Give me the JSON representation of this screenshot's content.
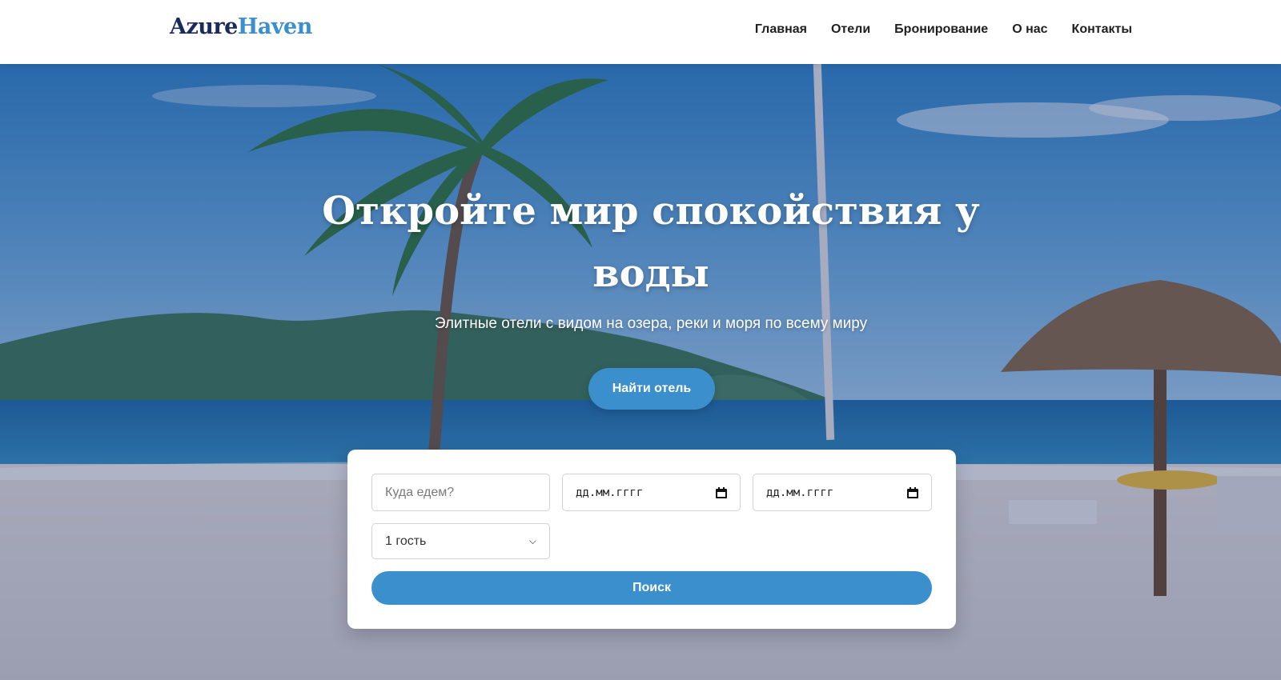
{
  "brand": {
    "part1": "Azure",
    "part2": "Haven"
  },
  "nav": {
    "items": [
      "Главная",
      "Отели",
      "Бронирование",
      "О нас",
      "Контакты"
    ]
  },
  "hero": {
    "title": "Откройте мир спокойствия у воды",
    "subtitle": "Элитные отели с видом на озера, реки и моря по всему миру",
    "cta": "Найти отель"
  },
  "search": {
    "destination_placeholder": "Куда едем?",
    "checkin_value": "дд.мм.гггг",
    "checkout_value": "дд.мм.гггг",
    "guests_selected": "1 гость",
    "submit_label": "Поиск"
  },
  "colors": {
    "brand_dark": "#1b2a5c",
    "accent": "#3b8fcd"
  },
  "icons": {
    "date": "calendar-icon",
    "select": "chevron-down-icon"
  }
}
